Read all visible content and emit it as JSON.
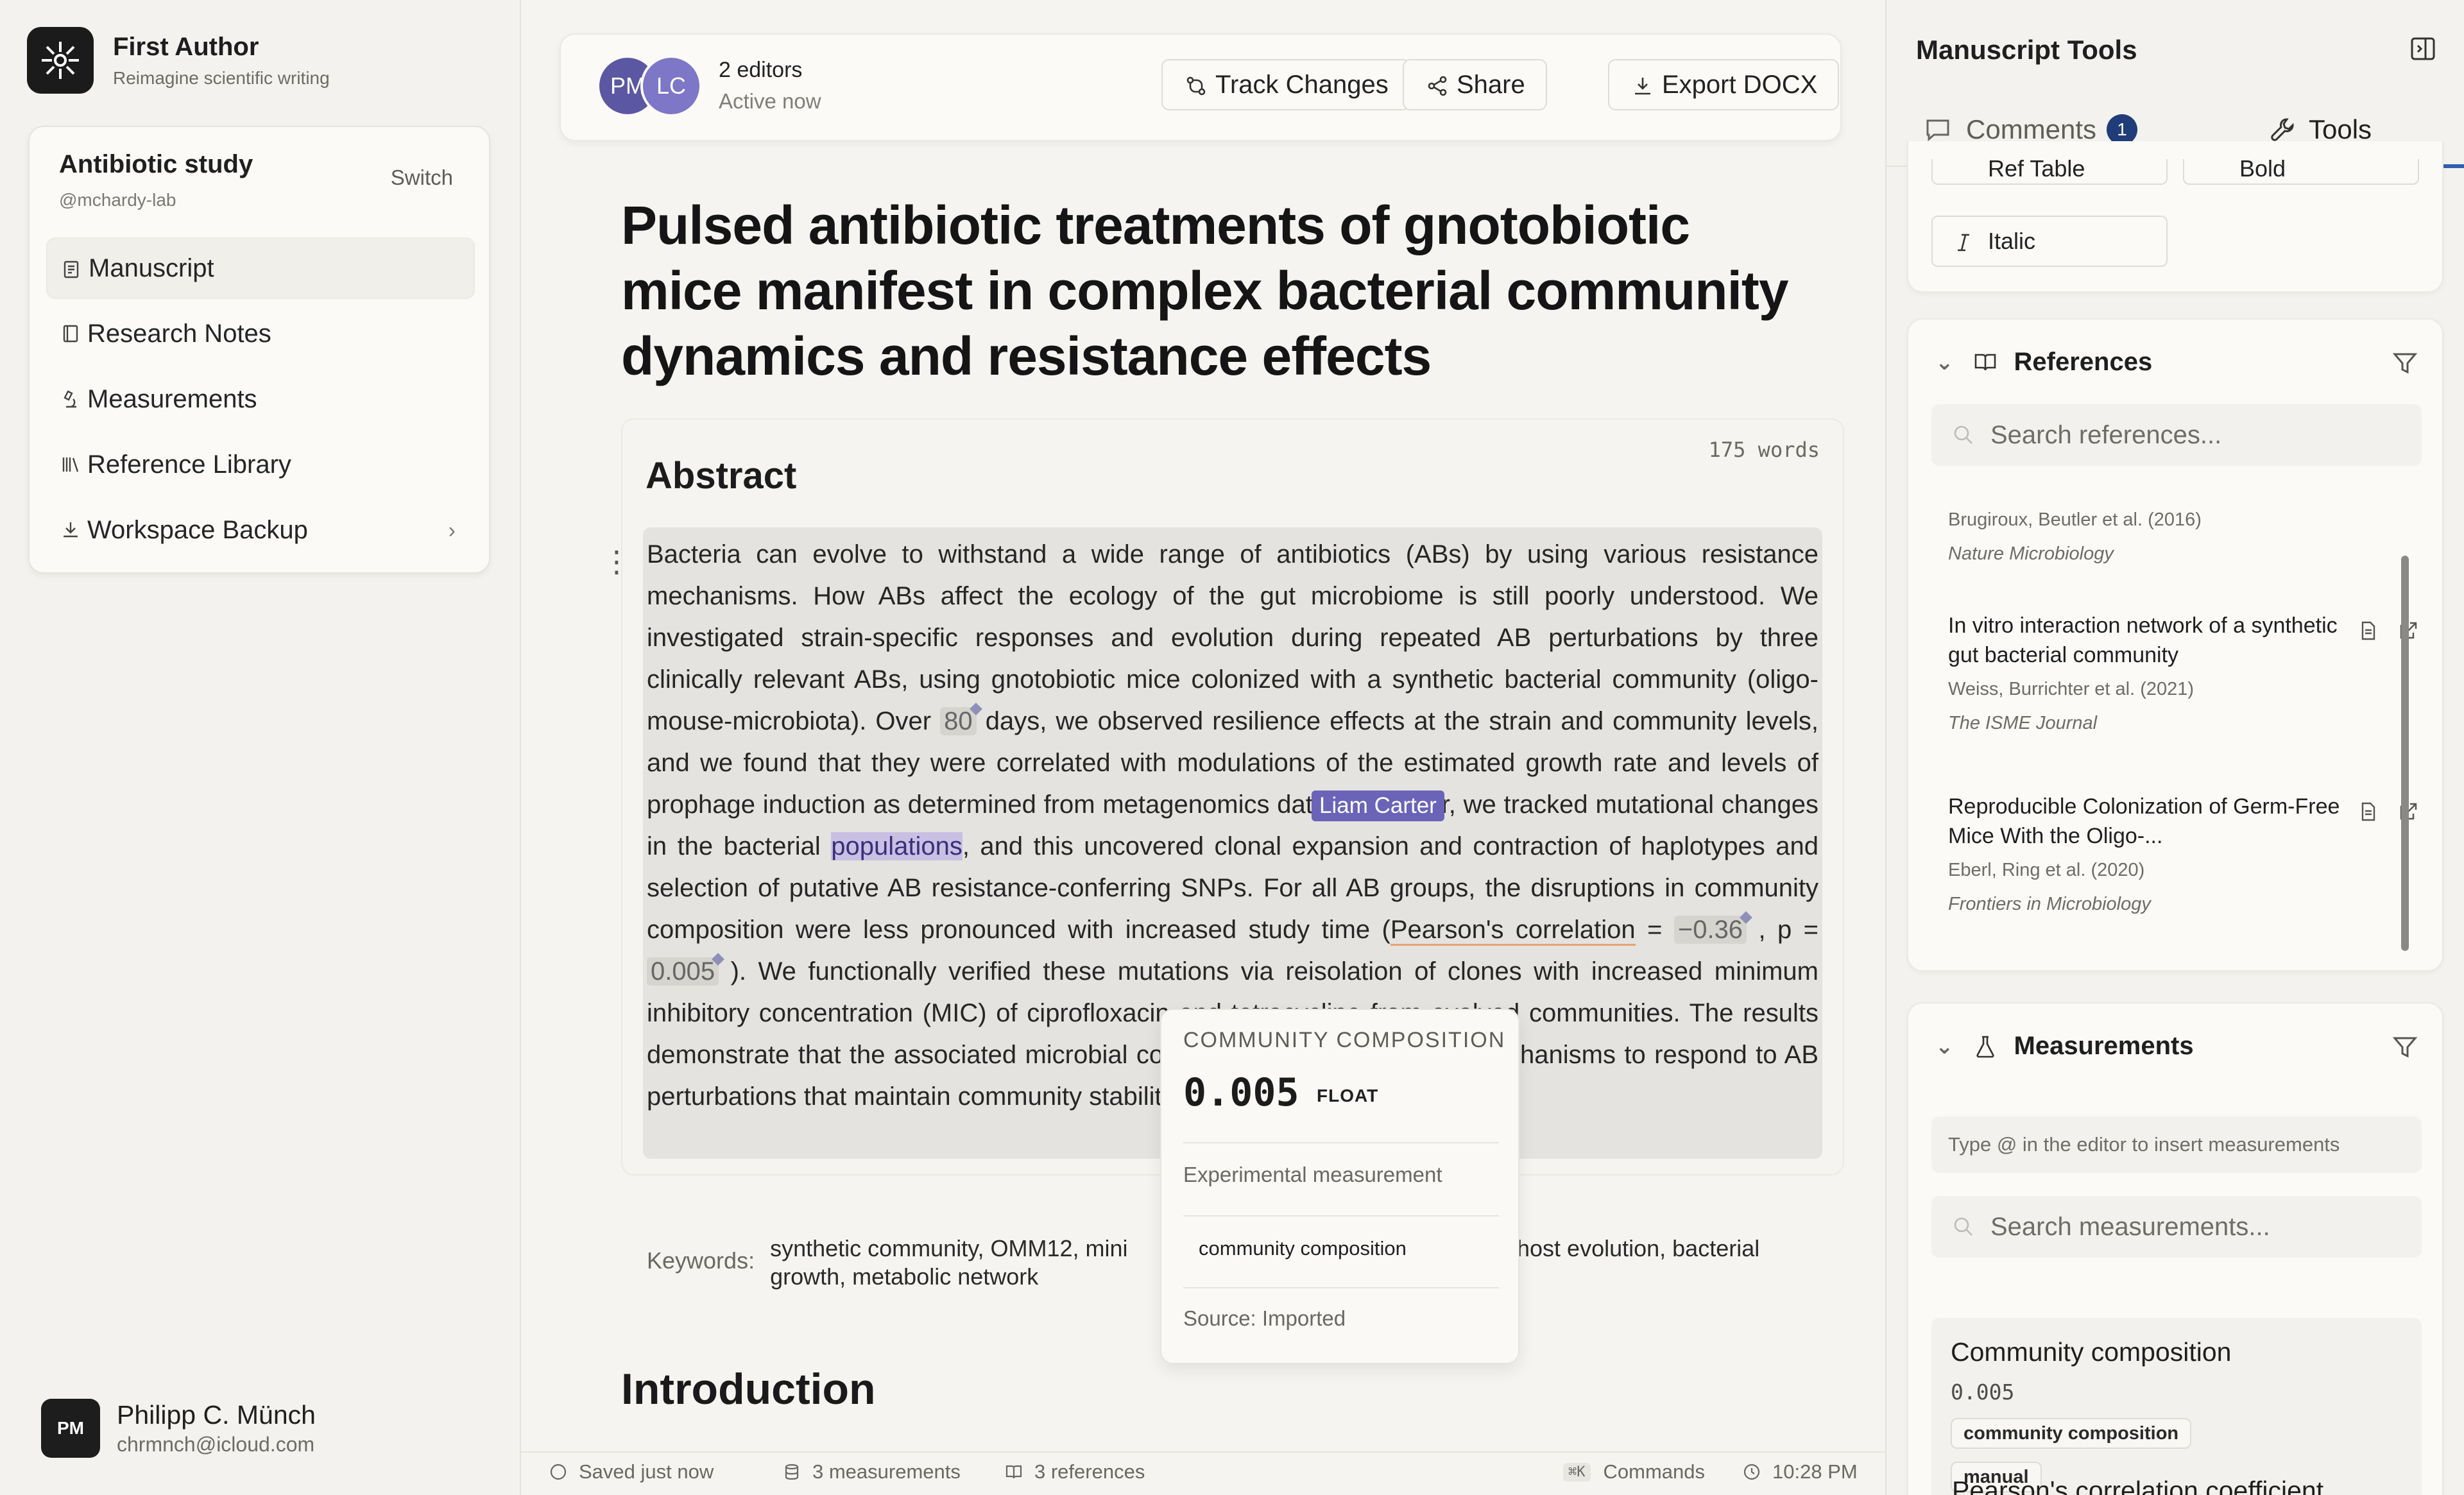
{
  "brand": {
    "name": "First Author",
    "tagline": "Reimagine scientific writing"
  },
  "project": {
    "name": "Antibiotic study",
    "handle": "@mchardy-lab",
    "switch_label": "Switch"
  },
  "nav": {
    "items": [
      {
        "label": "Manuscript",
        "icon": "manuscript-icon",
        "active": true
      },
      {
        "label": "Research Notes",
        "icon": "notebook-icon"
      },
      {
        "label": "Measurements",
        "icon": "microscope-icon"
      },
      {
        "label": "Reference Library",
        "icon": "library-icon"
      },
      {
        "label": "Workspace Backup",
        "icon": "download-icon"
      }
    ]
  },
  "user": {
    "initials": "PM",
    "name": "Philipp C. Münch",
    "email": "chrmnch@icloud.com"
  },
  "topbar": {
    "avatars": [
      "PM",
      "LC"
    ],
    "editors_count": "2 editors",
    "editors_status": "Active now",
    "track_changes": "Track Changes",
    "share": "Share",
    "export": "Export DOCX"
  },
  "document": {
    "title": "Pulsed antibiotic treatments of gnotobiotic mice manifest in complex bacterial community dynamics and resistance effects",
    "abstract_heading": "Abstract",
    "word_count": "175 words",
    "abstract": {
      "p1": "Bacteria can evolve to withstand a wide range of antibiotics (ABs) by using various resistance mechanisms. How ABs affect the ecology of the gut microbiome is still poorly understood. We investigated strain-specific responses and evolution during repeated AB perturbations by three clinically relevant ABs, using gnotobiotic mice colonized with a synthetic bacterial community (oligo-mouse-microbiota). Over ",
      "m1": "80",
      "p2": " days, we observed resilience effects at the strain and community levels, and we found that they were correlated with modulations of the estimated growth rate and levels of prophage induction as determined from metagenomics data. Moreover, we tracked mutational changes in the bacterial ",
      "highlight": "populations",
      "p3": ", and this uncovered clonal expansion and contraction of haplotypes and selection of putative AB resistance-conferring SNPs. For all AB groups, the disruptions in community composition were less pronounced with increased study time (",
      "pearson": "Pearson's correlation",
      "p4": " = ",
      "m2": "−0.36",
      "p5": " , p = ",
      "m3": "0.005",
      "p6": " ). We functionally verified these mutations via reisolation of clones with increased minimum inhibitory concentration (MIC) of ciprofloxacin and tetracycline from evolved communities. The results demonstrate that the associated microbial communities employ various mechanisms to respond to AB perturbations that maintain community stability."
    },
    "cursor_user": "Liam Carter",
    "keywords_label": "Keywords:",
    "keywords_part1": "synthetic community, OMM12, mini",
    "keywords_part1_line2": "growth, metabolic network",
    "keywords_part2": "host evolution, bacterial",
    "intro_heading": "Introduction"
  },
  "measurement_popup": {
    "heading": "COMMUNITY COMPOSITION",
    "value": "0.005",
    "type": "FLOAT",
    "description": "Experimental measurement",
    "tag": "community composition",
    "source": "Source: Imported"
  },
  "statusbar": {
    "saved": "Saved just now",
    "measurements": "3 measurements",
    "references": "3 references",
    "shortcut": "⌘K",
    "commands": "Commands",
    "time": "10:28 PM"
  },
  "right_panel": {
    "title": "Manuscript Tools",
    "tabs": {
      "comments": "Comments",
      "comments_count": "1",
      "tools": "Tools"
    },
    "format_buttons": {
      "ref_table": "Ref Table",
      "bold": "Bold",
      "italic": "Italic"
    },
    "references": {
      "heading": "References",
      "search_placeholder": "Search references...",
      "items": [
        {
          "title": "",
          "authors": "Brugiroux, Beutler et al. (2016)",
          "journal": "Nature Microbiology"
        },
        {
          "title": "In vitro interaction network of a synthetic gut bacterial community",
          "authors": "Weiss, Burrichter et al. (2021)",
          "journal": "The ISME Journal"
        },
        {
          "title": "Reproducible Colonization of Germ-Free Mice With the Oligo-...",
          "authors": "Eberl, Ring et al. (2020)",
          "journal": "Frontiers in Microbiology"
        }
      ]
    },
    "measurements": {
      "heading": "Measurements",
      "hint": "Type  @  in the editor to insert measurements",
      "search_placeholder": "Search measurements...",
      "card": {
        "name": "Community composition",
        "value": "0.005",
        "tag1": "community composition",
        "tag2": "manual"
      },
      "next_title": "Pearson's correlation coefficient"
    }
  }
}
